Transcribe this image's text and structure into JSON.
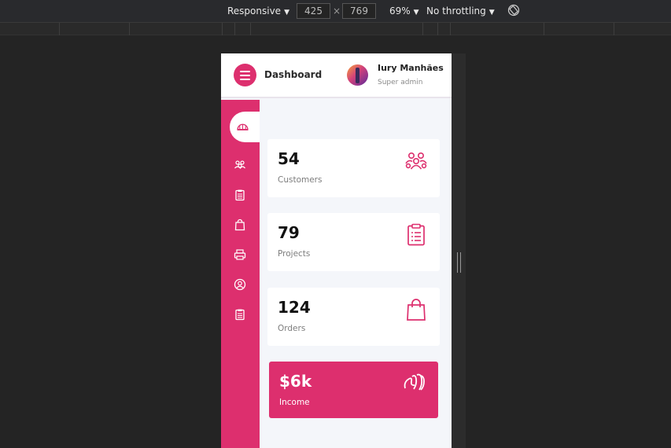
{
  "devtools": {
    "device": "Responsive",
    "width": "425",
    "times": "×",
    "height": "769",
    "zoom": "69%",
    "throttling": "No throttling",
    "caret": "▼"
  },
  "header": {
    "title": "Dashboard",
    "user_name": "Iury Manhães",
    "user_role": "Super admin"
  },
  "sidebar": {
    "items": [
      {
        "icon": "dashboard-icon",
        "active": true
      },
      {
        "icon": "users-icon"
      },
      {
        "icon": "clipboard-icon"
      },
      {
        "icon": "shopping-bag-icon"
      },
      {
        "icon": "printer-icon"
      },
      {
        "icon": "user-circle-icon"
      },
      {
        "icon": "clipboard-icon"
      }
    ]
  },
  "cards": [
    {
      "value": "54",
      "label": "Customers",
      "icon": "users-icon"
    },
    {
      "value": "79",
      "label": "Projects",
      "icon": "clipboard-list-icon"
    },
    {
      "value": "124",
      "label": "Orders",
      "icon": "shopping-bag-icon"
    },
    {
      "value": "$6k",
      "label": "Income",
      "icon": "payment-icon"
    }
  ],
  "colors": {
    "accent": "#dd2f6e",
    "background": "#f4f6fa",
    "devtools": "#242424"
  }
}
